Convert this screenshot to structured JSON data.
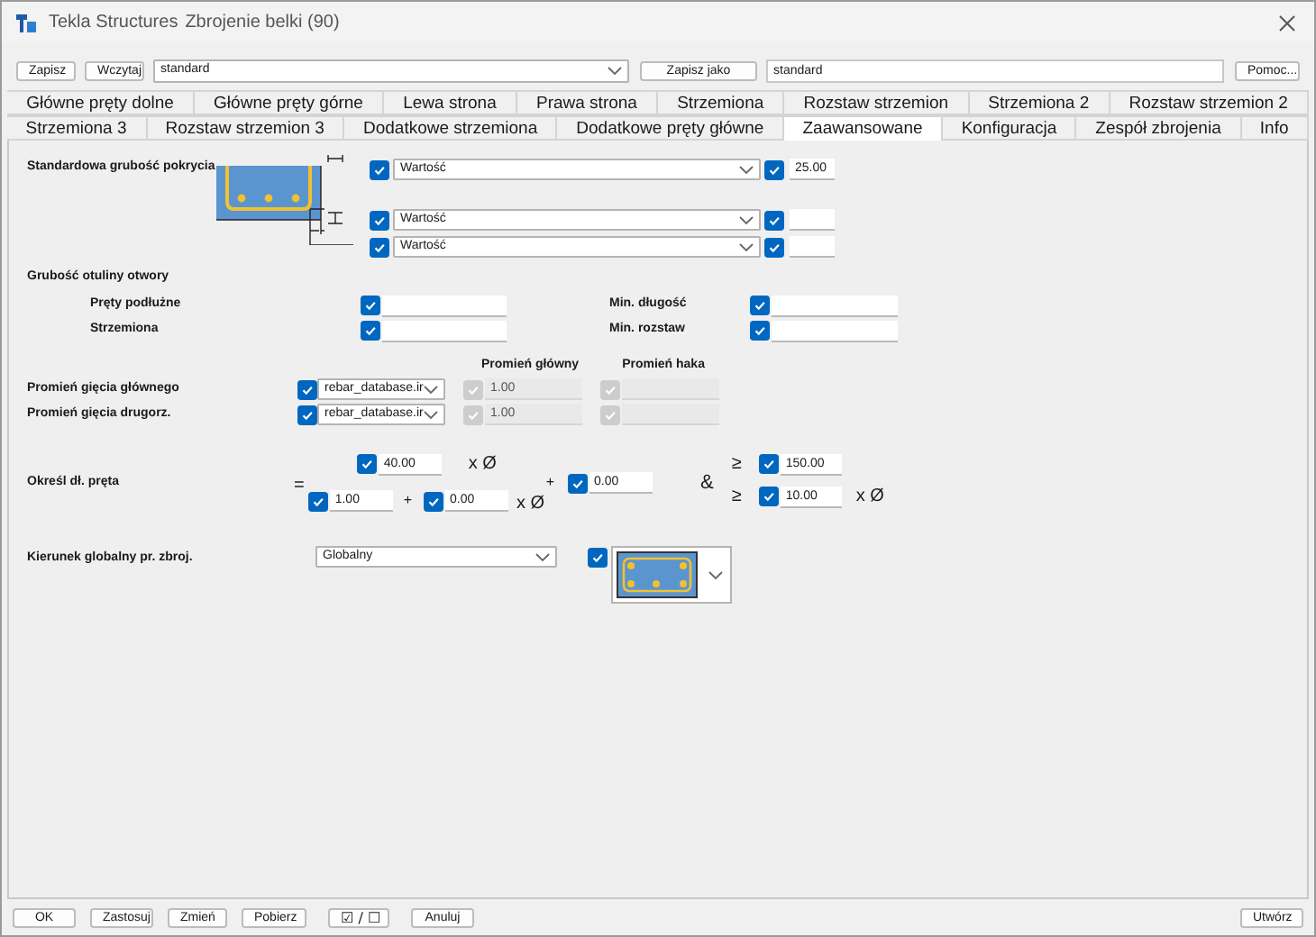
{
  "window": {
    "app": "Tekla Structures",
    "title": "Zbrojenie belki (90)"
  },
  "toolbar": {
    "save": "Zapisz",
    "load": "Wczytaj",
    "preset": "standard",
    "save_as": "Zapisz jako",
    "save_as_name": "standard",
    "help": "Pomoc..."
  },
  "tab_rows": [
    [
      {
        "label": "Główne pręty dolne",
        "selected": false
      },
      {
        "label": "Główne pręty górne",
        "selected": false
      },
      {
        "label": "Lewa strona",
        "selected": false
      },
      {
        "label": "Prawa strona",
        "selected": false
      },
      {
        "label": "Strzemiona",
        "selected": false
      },
      {
        "label": "Rozstaw strzemion",
        "selected": false
      },
      {
        "label": "Strzemiona 2",
        "selected": false
      },
      {
        "label": "Rozstaw strzemion 2",
        "selected": false
      }
    ],
    [
      {
        "label": "Strzemiona 3",
        "selected": false
      },
      {
        "label": "Rozstaw strzemion 3",
        "selected": false
      },
      {
        "label": "Dodatkowe strzemiona",
        "selected": false
      },
      {
        "label": "Dodatkowe pręty główne",
        "selected": false
      },
      {
        "label": "Zaawansowane",
        "selected": true
      },
      {
        "label": "Konfiguracja",
        "selected": false
      },
      {
        "label": "Zespół zbrojenia",
        "selected": false
      },
      {
        "label": "Info",
        "selected": false
      }
    ]
  ],
  "cover": {
    "label": "Standardowa grubość pokrycia",
    "rows": [
      {
        "checked": true,
        "option": "Wartość",
        "value_checked": true,
        "value": "25.00"
      },
      {
        "checked": true,
        "option": "Wartość",
        "value_checked": true
      },
      {
        "checked": true,
        "option": "Wartość",
        "value_checked": true
      }
    ]
  },
  "opening_cover": {
    "label": "Grubość otuliny  otwory",
    "fields": [
      {
        "label": "Pręty podłużne",
        "checked": true
      },
      {
        "label": "Min. długość",
        "checked": true
      },
      {
        "label": "Strzemiona",
        "checked": true
      },
      {
        "label": "Min. rozstaw",
        "checked": true
      }
    ]
  },
  "bend_radius": {
    "headers": [
      "Promień główny",
      "Promień haka"
    ],
    "rows": [
      {
        "label": "Promień gięcia głównego",
        "checked": true,
        "option": "rebar_database.ir",
        "main_checked": true,
        "main_disabled": true,
        "main_value": "1.00",
        "hook_checked": true,
        "hook_disabled": true
      },
      {
        "label": "Promień gięcia drugorz.",
        "checked": true,
        "option": "rebar_database.ir",
        "main_checked": true,
        "main_disabled": true,
        "main_value": "1.00",
        "hook_checked": true,
        "hook_disabled": true
      }
    ]
  },
  "length": {
    "label": "Określ dł. pręta",
    "equals": "=",
    "numerator": {
      "checked": true,
      "value": "40.00"
    },
    "times_1": "x Ø",
    "denominator_a": {
      "checked": true,
      "value": "1.00"
    },
    "plus_1": "+",
    "denominator_b": {
      "checked": true,
      "value": "0.00"
    },
    "times_2": "x Ø",
    "plus_2": "+",
    "offset": {
      "checked": true,
      "value": "0.00"
    },
    "and": "&",
    "minimums": [
      {
        "sign": "≥",
        "checked": true,
        "value": "150.00"
      },
      {
        "sign": "≥",
        "checked": true,
        "value": "10.00",
        "suffix": "x Ø"
      }
    ]
  },
  "direction": {
    "label": "Kierunek globalny pr. zbroj.",
    "option": "Globalny",
    "checked": true
  },
  "footer": {
    "left": [
      "OK",
      "Zastosuj",
      "Zmień",
      "Pobierz",
      "☑ / ☐",
      "Anuluj"
    ],
    "right": "Utwórz"
  }
}
